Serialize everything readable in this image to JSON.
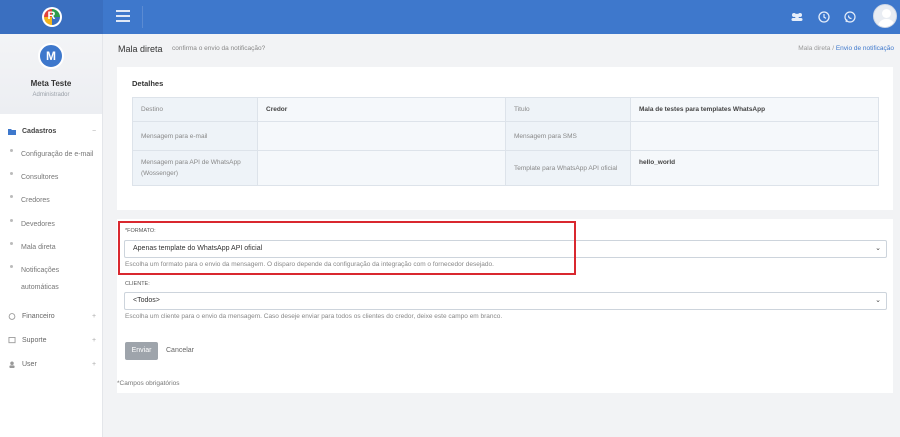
{
  "topbar": {
    "brand_letter": "R",
    "icons": [
      "users-icon",
      "clock-icon",
      "whatsapp-icon"
    ]
  },
  "sidebar": {
    "profile": {
      "initial": "M",
      "name": "Meta Teste",
      "role": "Administrador"
    },
    "sections": [
      {
        "label": "Cadastros",
        "icon": "folder-icon",
        "chevron": "−",
        "expanded": true
      },
      {
        "label": "Financeiro",
        "icon": "finance-icon",
        "chevron": "+"
      },
      {
        "label": "Suporte",
        "icon": "chat-icon",
        "chevron": "+"
      },
      {
        "label": "User",
        "icon": "user-icon",
        "chevron": "+"
      }
    ],
    "items": [
      {
        "label": "Configuração de e-mail"
      },
      {
        "label": "Consultores"
      },
      {
        "label": "Credores"
      },
      {
        "label": "Devedores"
      },
      {
        "label": "Mala direta"
      },
      {
        "label": "Notificações automáticas"
      }
    ]
  },
  "header": {
    "title": "Mala direta",
    "subtitle": "confirma o envio da notificação?",
    "breadcrumb": {
      "parent": "Mala direta",
      "separator": "/",
      "current": "Envio de notificação"
    }
  },
  "details": {
    "title": "Detalhes",
    "rows": [
      [
        "Destino",
        "Credor",
        "Titulo",
        "Mala de testes para templates WhatsApp"
      ],
      [
        "Mensagem para e-mail",
        "",
        "Mensagem para SMS",
        ""
      ],
      [
        "Mensagem para API de WhatsApp (Wossenger)",
        "",
        "Template para WhatsApp API oficial",
        "hello_world"
      ]
    ]
  },
  "form": {
    "formato_label": "*FORMATO:",
    "formato_value": "Apenas template do WhatsApp API oficial",
    "formato_help": "Escolha um formato para o envio da mensagem. O disparo depende da configuração da integração com o fornecedor desejado.",
    "cliente_label": "CLIENTE:",
    "cliente_value": "<Todos>",
    "cliente_help": "Escolha um cliente para o envio da mensagem. Caso deseje enviar para todos os clientes do credor, deixe este campo em branco.",
    "send_label": "Enviar",
    "cancel_label": "Cancelar",
    "required_note": "*Campos obrigatórios"
  },
  "colors": {
    "primary": "#3e78cc",
    "highlight": "#d9282f"
  }
}
